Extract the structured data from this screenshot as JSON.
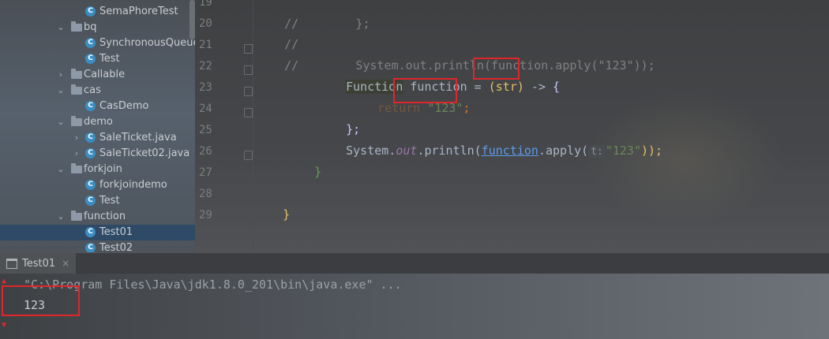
{
  "project_tree": {
    "items": [
      {
        "label": "SemaPhoreTest",
        "kind": "class",
        "level": 2,
        "arrow": ""
      },
      {
        "label": "bq",
        "kind": "folder",
        "level": 1,
        "arrow": "down"
      },
      {
        "label": "SynchronousQueueTe",
        "kind": "class",
        "level": 2,
        "arrow": ""
      },
      {
        "label": "Test",
        "kind": "class",
        "level": 2,
        "arrow": ""
      },
      {
        "label": "Callable",
        "kind": "folder",
        "level": 1,
        "arrow": "right"
      },
      {
        "label": "cas",
        "kind": "folder",
        "level": 1,
        "arrow": "down"
      },
      {
        "label": "CasDemo",
        "kind": "class",
        "level": 2,
        "arrow": ""
      },
      {
        "label": "demo",
        "kind": "folder",
        "level": 1,
        "arrow": "down"
      },
      {
        "label": "SaleTicket.java",
        "kind": "class",
        "level": 2,
        "arrow": "right"
      },
      {
        "label": "SaleTicket02.java",
        "kind": "class",
        "level": 2,
        "arrow": "right"
      },
      {
        "label": "forkjoin",
        "kind": "folder",
        "level": 1,
        "arrow": "down"
      },
      {
        "label": "forkjoindemo",
        "kind": "class",
        "level": 2,
        "arrow": ""
      },
      {
        "label": "Test",
        "kind": "class",
        "level": 2,
        "arrow": ""
      },
      {
        "label": "function",
        "kind": "folder",
        "level": 1,
        "arrow": "down"
      },
      {
        "label": "Test01",
        "kind": "class",
        "level": 2,
        "arrow": "",
        "selected": true
      },
      {
        "label": "Test02",
        "kind": "class",
        "level": 2,
        "arrow": ""
      }
    ]
  },
  "editor": {
    "line_numbers": [
      "19",
      "20",
      "21",
      "22",
      "23",
      "24",
      "25",
      "26",
      "27",
      "28",
      "29"
    ],
    "code": {
      "l19_comment": "//",
      "l19_rest": "        };",
      "l20_comment": "//",
      "l21_comment": "//",
      "l21_rest": "        System.out.println(function.apply(\"123\"));",
      "l22_type": "Function",
      "l22_var": " function = ",
      "l22_param": "(str)",
      "l22_arrow": " -> ",
      "l22_brace": "{",
      "l23_return": "return",
      "l23_str": "\"123\"",
      "l23_semi": ";",
      "l24_close": "};",
      "l25_sys": "System.",
      "l25_out": "out",
      "l25_println": ".println(",
      "l25_func": "function",
      "l25_apply": ".apply(",
      "l25_hint": "t:",
      "l25_str": "\"123\"",
      "l25_end": "));",
      "l26_brace": "}",
      "l28_brace": "}"
    }
  },
  "run_panel": {
    "tab_label": "Test01",
    "close_glyph": "×",
    "command": "\"C:\\Program Files\\Java\\jdk1.8.0_201\\bin\\java.exe\" ...",
    "output": "123"
  }
}
